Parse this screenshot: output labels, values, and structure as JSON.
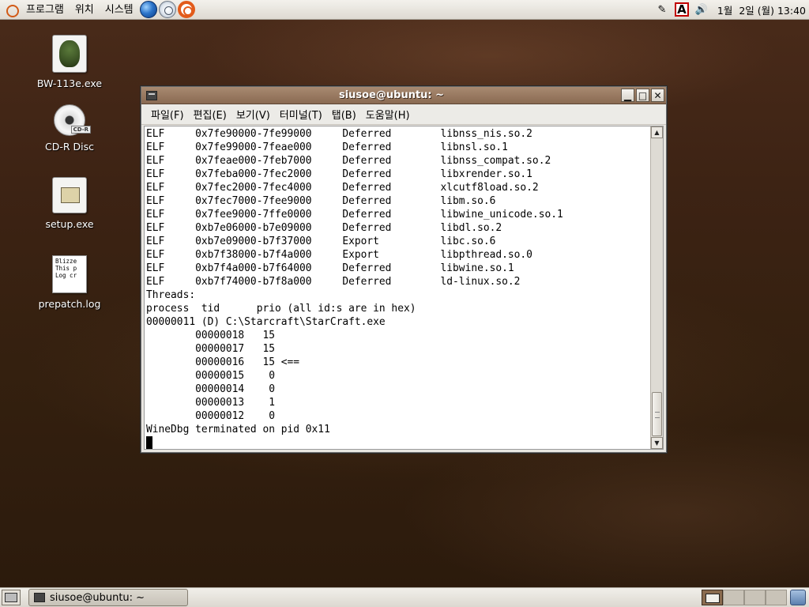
{
  "top_panel": {
    "menus": [
      "프로그램",
      "위치",
      "시스템"
    ],
    "ime_label": "A",
    "clock": "1월  2일 (월) 13:40"
  },
  "desktop_icons": [
    {
      "label": "BW-113e.exe"
    },
    {
      "label": "CD-R Disc",
      "badge": "CD-R"
    },
    {
      "label": "setup.exe"
    },
    {
      "label": "prepatch.log",
      "preview_lines": [
        "Blizze",
        "This p",
        "",
        "Log cr"
      ]
    }
  ],
  "terminal": {
    "title": "siusoe@ubuntu: ~",
    "menu": [
      "파일(F)",
      "편집(E)",
      "보기(V)",
      "터미널(T)",
      "탭(B)",
      "도움말(H)"
    ],
    "lines": [
      "ELF     0x7fe90000-7fe99000     Deferred        libnss_nis.so.2",
      "ELF     0x7fe99000-7feae000     Deferred        libnsl.so.1",
      "ELF     0x7feae000-7feb7000     Deferred        libnss_compat.so.2",
      "ELF     0x7feba000-7fec2000     Deferred        libxrender.so.1",
      "ELF     0x7fec2000-7fec4000     Deferred        xlcutf8load.so.2",
      "ELF     0x7fec7000-7fee9000     Deferred        libm.so.6",
      "ELF     0x7fee9000-7ffe0000     Deferred        libwine_unicode.so.1",
      "ELF     0xb7e06000-b7e09000     Deferred        libdl.so.2",
      "ELF     0xb7e09000-b7f37000     Export          libc.so.6",
      "ELF     0xb7f38000-b7f4a000     Export          libpthread.so.0",
      "ELF     0xb7f4a000-b7f64000     Deferred        libwine.so.1",
      "ELF     0xb7f74000-b7f8a000     Deferred        ld-linux.so.2",
      "Threads:",
      "process  tid      prio (all id:s are in hex)",
      "00000011 (D) C:\\Starcraft\\StarCraft.exe",
      "        00000018   15",
      "        00000017   15",
      "        00000016   15 <==",
      "        00000015    0",
      "        00000014    0",
      "        00000013    1",
      "        00000012    0",
      "WineDbg terminated on pid 0x11"
    ]
  },
  "taskbar": {
    "window_button": "siusoe@ubuntu: ~"
  }
}
